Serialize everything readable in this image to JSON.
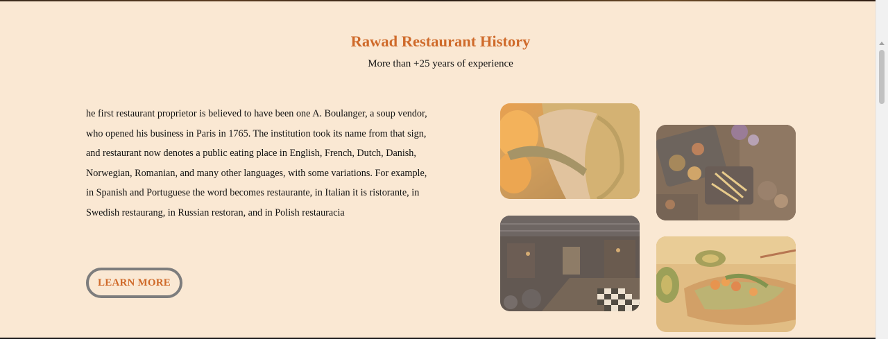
{
  "history": {
    "title": "Rawad Restaurant History",
    "subtitle": "More than +25 years of experience",
    "paragraph_1": "he first restaurant proprietor is believed to have been one A. Boulanger, a soup vendor, who opened his business in Paris in 1765. The institution took its name from that sign,",
    "paragraph_2": "and restaurant now denotes a public eating place in English, French, Dutch, Danish, Norwegian, Romanian, and many other languages, with some variations. For example, in Spanish and Portuguese the word becomes restaurante, in Italian it is ristorante, in Swedish restaurang, in Russian restoran, and in Polish restauracia",
    "learn_more_label": "LEARN MORE"
  },
  "gallery": {
    "images": [
      "roasted-meat-photo",
      "food-platter-photo",
      "restaurant-interior-photo",
      "avocado-toast-photo"
    ]
  },
  "colors": {
    "background": "#fae8d3",
    "accent": "#cf6a2a",
    "button_border": "#7d7d7d"
  }
}
